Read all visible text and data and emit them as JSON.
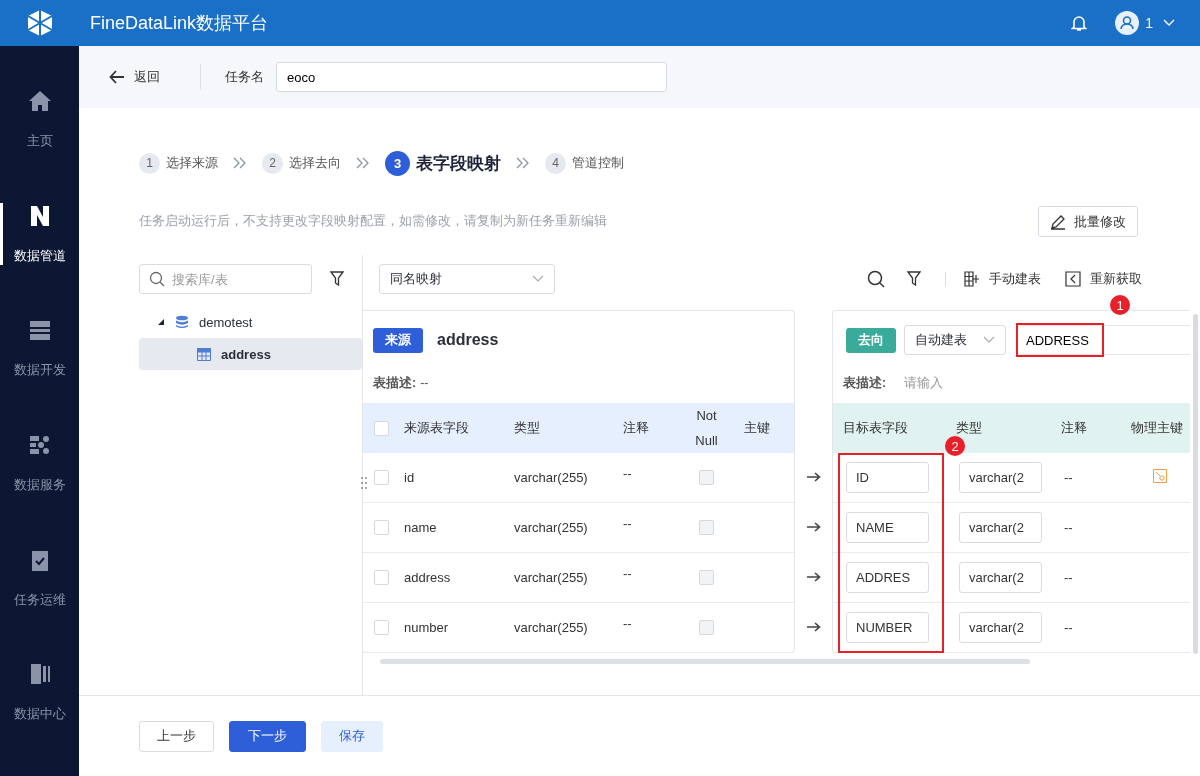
{
  "app": {
    "title": "FineDataLink数据平台",
    "user": "1"
  },
  "sidebar": [
    {
      "label": "主页",
      "selected": false
    },
    {
      "label": "数据管道",
      "selected": true
    },
    {
      "label": "数据开发",
      "selected": false
    },
    {
      "label": "数据服务",
      "selected": false
    },
    {
      "label": "任务运维",
      "selected": false
    },
    {
      "label": "数据中心",
      "selected": false
    }
  ],
  "header": {
    "back": "返回",
    "task_label": "任务名",
    "task_name": "eoco"
  },
  "steps": [
    {
      "number": "1",
      "label": "选择来源",
      "selected": false
    },
    {
      "number": "2",
      "label": "选择去向",
      "selected": false
    },
    {
      "number": "3",
      "label": "表字段映射",
      "selected": true
    },
    {
      "number": "4",
      "label": "管道控制",
      "selected": false
    }
  ],
  "notice": "任务启动运行后，不支持更改字段映射配置，如需修改，请复制为新任务重新编辑",
  "batch_edit": "批量修改",
  "tree": {
    "search_placeholder": "搜索库/表",
    "items": [
      {
        "label": "demotest",
        "expanded": true,
        "selected": false,
        "children": [
          {
            "label": "address",
            "selected": true
          }
        ]
      }
    ]
  },
  "mapping_mode": "同名映射",
  "toolbar": [
    "手动建表",
    "重新获取"
  ],
  "source": {
    "tag": "来源",
    "table": "address",
    "desc_label": "表描述:",
    "desc": "--",
    "select_all": false,
    "columns": [
      "来源表字段",
      "类型",
      "注释",
      "Not Null",
      "主键"
    ],
    "rows": [
      {
        "field": "id",
        "type": "varchar(255)",
        "comment": "--",
        "checked": false,
        "not_null": false
      },
      {
        "field": "name",
        "type": "varchar(255)",
        "comment": "--",
        "checked": false,
        "not_null": false
      },
      {
        "field": "address",
        "type": "varchar(255)",
        "comment": "--",
        "checked": false,
        "not_null": false
      },
      {
        "field": "number",
        "type": "varchar(255)",
        "comment": "--",
        "checked": false,
        "not_null": false
      }
    ]
  },
  "target": {
    "tag": "去向",
    "mode": "自动建表",
    "table": "ADDRESS",
    "desc_label": "表描述:",
    "desc_placeholder": "请输入",
    "columns": [
      "目标表字段",
      "类型",
      "注释",
      "物理主键"
    ],
    "rows": [
      {
        "field": "ID",
        "type": "varchar(2",
        "comment": "--",
        "primary_key": true
      },
      {
        "field": "NAME",
        "type": "varchar(2",
        "comment": "--",
        "primary_key": false
      },
      {
        "field": "ADDRES",
        "type": "varchar(2",
        "comment": "--",
        "primary_key": false
      },
      {
        "field": "NUMBER",
        "type": "varchar(2",
        "comment": "--",
        "primary_key": false
      }
    ]
  },
  "annotations": [
    {
      "number": "1"
    },
    {
      "number": "2"
    }
  ],
  "footer": {
    "prev": "上一步",
    "next": "下一步",
    "save": "保存"
  }
}
